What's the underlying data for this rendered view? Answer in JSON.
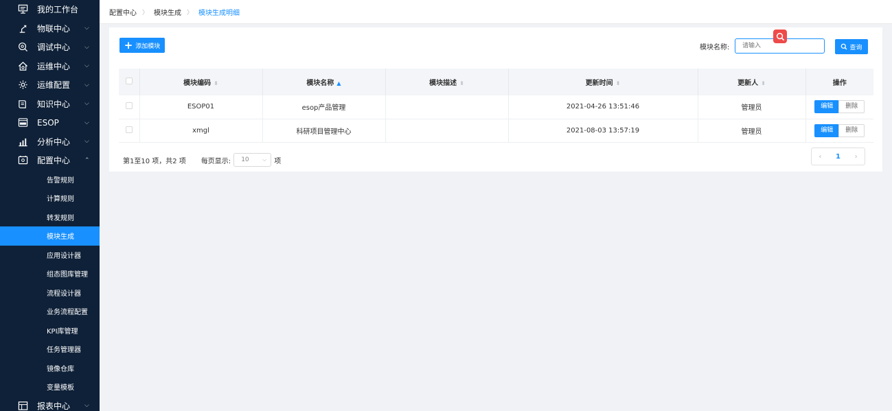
{
  "sidebar": {
    "top_item": {
      "label": "我的工作台",
      "icon": "monitor-icon"
    },
    "items": [
      {
        "label": "物联中心",
        "icon": "robot-arm-icon"
      },
      {
        "label": "调试中心",
        "icon": "search-gear-icon"
      },
      {
        "label": "运维中心",
        "icon": "home-gear-icon"
      },
      {
        "label": "运维配置",
        "icon": "gear-icon"
      },
      {
        "label": "知识中心",
        "icon": "book-icon"
      },
      {
        "label": "ESOP",
        "icon": "esop-icon"
      },
      {
        "label": "分析中心",
        "icon": "bar-chart-icon"
      },
      {
        "label": "配置中心",
        "icon": "config-icon"
      }
    ],
    "sub_items": [
      {
        "label": "告警规则"
      },
      {
        "label": "计算规则"
      },
      {
        "label": "转发规则"
      },
      {
        "label": "模块生成",
        "active": true
      },
      {
        "label": "应用设计器"
      },
      {
        "label": "组态图库管理"
      },
      {
        "label": "流程设计器"
      },
      {
        "label": "业务流程配置"
      },
      {
        "label": "KPI库管理"
      },
      {
        "label": "任务管理器"
      },
      {
        "label": "镜像仓库"
      },
      {
        "label": "变量模板"
      }
    ],
    "bottom_item": {
      "label": "报表中心",
      "icon": "report-icon"
    }
  },
  "breadcrumb": {
    "items": [
      "配置中心",
      "模块生成",
      "模块生成明细"
    ]
  },
  "toolbar": {
    "add_label": "添加模块",
    "search_label": "模块名称:",
    "search_placeholder": "请输入",
    "query_label": "查询"
  },
  "table": {
    "headers": [
      "模块编码",
      "模块名称",
      "模块描述",
      "更新时间",
      "更新人",
      "操作"
    ],
    "rows": [
      {
        "code": "ESOP01",
        "name": "esop产品管理",
        "desc": "",
        "time": "2021-04-26 13:51:46",
        "user": "管理员"
      },
      {
        "code": "xmgl",
        "name": "科研项目管理中心",
        "desc": "",
        "time": "2021-08-03 13:57:19",
        "user": "管理员"
      }
    ],
    "edit_label": "编辑",
    "delete_label": "删除"
  },
  "pagination": {
    "summary": "第1至10 项，共2 项",
    "per_page_label": "每页显示:",
    "per_page_value": "10",
    "unit": "项",
    "current_page": "1"
  },
  "colors": {
    "sidebar_bg": "#0f2138",
    "accent": "#1890ff",
    "red": "#ef4a4a"
  }
}
